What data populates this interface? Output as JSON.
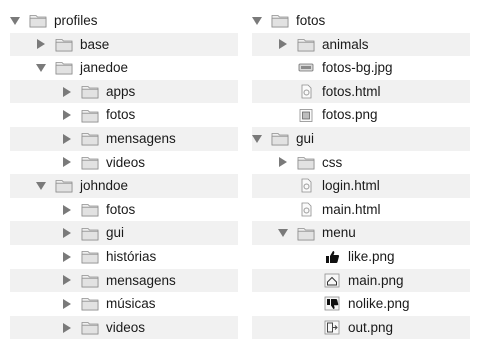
{
  "left_tree": [
    {
      "label": "profiles",
      "depth": 0,
      "expander": "open",
      "icon": "folder-icon"
    },
    {
      "label": "base",
      "depth": 1,
      "expander": "closed",
      "icon": "folder-icon"
    },
    {
      "label": "janedoe",
      "depth": 1,
      "expander": "open",
      "icon": "folder-icon"
    },
    {
      "label": "apps",
      "depth": 2,
      "expander": "closed",
      "icon": "folder-icon"
    },
    {
      "label": "fotos",
      "depth": 2,
      "expander": "closed",
      "icon": "folder-icon"
    },
    {
      "label": "mensagens",
      "depth": 2,
      "expander": "closed",
      "icon": "folder-icon"
    },
    {
      "label": "videos",
      "depth": 2,
      "expander": "closed",
      "icon": "folder-icon"
    },
    {
      "label": "johndoe",
      "depth": 1,
      "expander": "open",
      "icon": "folder-icon"
    },
    {
      "label": "fotos",
      "depth": 2,
      "expander": "closed",
      "icon": "folder-icon"
    },
    {
      "label": "gui",
      "depth": 2,
      "expander": "closed",
      "icon": "folder-icon"
    },
    {
      "label": "histórias",
      "depth": 2,
      "expander": "closed",
      "icon": "folder-icon"
    },
    {
      "label": "mensagens",
      "depth": 2,
      "expander": "closed",
      "icon": "folder-icon"
    },
    {
      "label": "músicas",
      "depth": 2,
      "expander": "closed",
      "icon": "folder-icon"
    },
    {
      "label": "videos",
      "depth": 2,
      "expander": "closed",
      "icon": "folder-icon"
    }
  ],
  "right_tree": [
    {
      "label": "fotos",
      "depth": 0,
      "expander": "open",
      "icon": "folder-icon"
    },
    {
      "label": "animals",
      "depth": 1,
      "expander": "closed",
      "icon": "folder-icon"
    },
    {
      "label": "fotos-bg.jpg",
      "depth": 1,
      "expander": "none",
      "icon": "jpg-file-icon"
    },
    {
      "label": "fotos.html",
      "depth": 1,
      "expander": "none",
      "icon": "html-file-icon"
    },
    {
      "label": "fotos.png",
      "depth": 1,
      "expander": "none",
      "icon": "png-file-icon"
    },
    {
      "label": "gui",
      "depth": 0,
      "expander": "open",
      "icon": "folder-icon"
    },
    {
      "label": "css",
      "depth": 1,
      "expander": "closed",
      "icon": "folder-icon"
    },
    {
      "label": "login.html",
      "depth": 1,
      "expander": "none",
      "icon": "html-file-icon"
    },
    {
      "label": "main.html",
      "depth": 1,
      "expander": "none",
      "icon": "html-file-icon"
    },
    {
      "label": "menu",
      "depth": 1,
      "expander": "open",
      "icon": "folder-icon"
    },
    {
      "label": "like.png",
      "depth": 2,
      "expander": "none",
      "icon": "thumbs-up-icon"
    },
    {
      "label": "main.png",
      "depth": 2,
      "expander": "none",
      "icon": "home-image-icon"
    },
    {
      "label": "nolike.png",
      "depth": 2,
      "expander": "none",
      "icon": "thumbs-down-icon"
    },
    {
      "label": "out.png",
      "depth": 2,
      "expander": "none",
      "icon": "exit-image-icon"
    }
  ]
}
